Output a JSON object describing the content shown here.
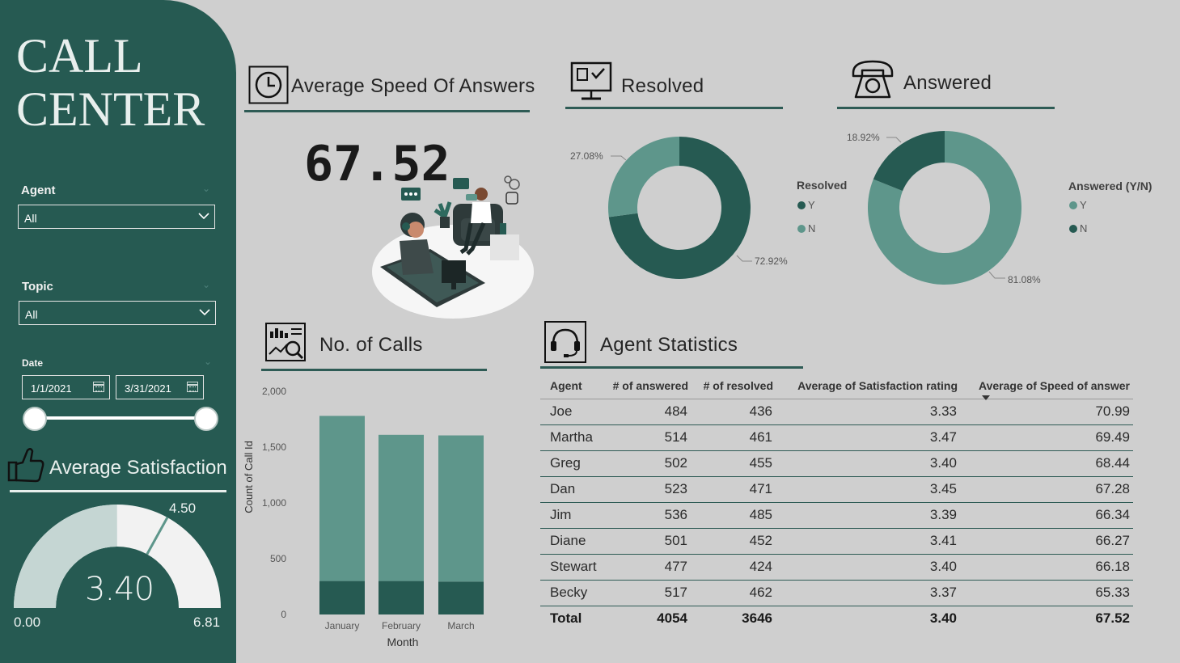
{
  "app": {
    "title_line1": "CALL",
    "title_line2": "CENTER"
  },
  "filters": {
    "agent": {
      "label": "Agent",
      "value": "All"
    },
    "topic": {
      "label": "Topic",
      "value": "All"
    },
    "date": {
      "label": "Date",
      "start": "1/1/2021",
      "end": "3/31/2021"
    }
  },
  "avg_satisfaction": {
    "title": "Average Satisfaction",
    "value": "3.40",
    "min": "0.00",
    "max": "6.81",
    "target": "4.50",
    "value_num": 3.4,
    "min_num": 0,
    "max_num": 6.81,
    "target_num": 4.5
  },
  "avg_speed": {
    "title": "Average Speed Of Answers",
    "value": "67.52"
  },
  "resolved": {
    "title": "Resolved",
    "legend_title": "Resolved",
    "legend": [
      "Y",
      "N"
    ],
    "slices": [
      {
        "name": "Y",
        "value": 72.92,
        "label": "72.92%",
        "color": "#265a52"
      },
      {
        "name": "N",
        "value": 27.08,
        "label": "27.08%",
        "color": "#5e968b"
      }
    ]
  },
  "answered": {
    "title": "Answered",
    "legend_title": "Answered (Y/N)",
    "legend": [
      "Y",
      "N"
    ],
    "slices": [
      {
        "name": "Y",
        "value": 81.08,
        "label": "81.08%",
        "color": "#5e968b"
      },
      {
        "name": "N",
        "value": 18.92,
        "label": "18.92%",
        "color": "#265a52"
      }
    ]
  },
  "calls": {
    "title": "No. of Calls",
    "chart_data": {
      "type": "bar",
      "stacked": true,
      "categories": [
        "January",
        "February",
        "March"
      ],
      "series": [
        {
          "values": [
            300,
            300,
            295
          ],
          "color": "#265a52"
        },
        {
          "values": [
            1480,
            1310,
            1310
          ],
          "color": "#5e968b"
        }
      ],
      "xlabel": "Month",
      "ylabel": "Count of Call Id",
      "ylim": [
        0,
        2000
      ],
      "yticks": [
        "2,000",
        "1,500",
        "1,000",
        "500",
        "0"
      ],
      "ytick_values": [
        2000,
        1500,
        1000,
        500,
        0
      ]
    }
  },
  "agent_stats": {
    "title": "Agent Statistics",
    "columns": [
      "Agent",
      "# of answered",
      "# of resolved",
      "Average of Satisfaction rating",
      "Average of Speed of answer"
    ],
    "rows": [
      [
        "Joe",
        "484",
        "436",
        "3.33",
        "70.99"
      ],
      [
        "Martha",
        "514",
        "461",
        "3.47",
        "69.49"
      ],
      [
        "Greg",
        "502",
        "455",
        "3.40",
        "68.44"
      ],
      [
        "Dan",
        "523",
        "471",
        "3.45",
        "67.28"
      ],
      [
        "Jim",
        "536",
        "485",
        "3.39",
        "66.34"
      ],
      [
        "Diane",
        "501",
        "452",
        "3.41",
        "66.27"
      ],
      [
        "Stewart",
        "477",
        "424",
        "3.40",
        "66.18"
      ],
      [
        "Becky",
        "517",
        "462",
        "3.37",
        "65.33"
      ]
    ],
    "total": [
      "Total",
      "4054",
      "3646",
      "3.40",
      "67.52"
    ]
  },
  "colors": {
    "dark_green": "#265a52",
    "mid_green": "#5e968b",
    "light_green": "#c5d6d3",
    "background": "#cfcfcf"
  }
}
